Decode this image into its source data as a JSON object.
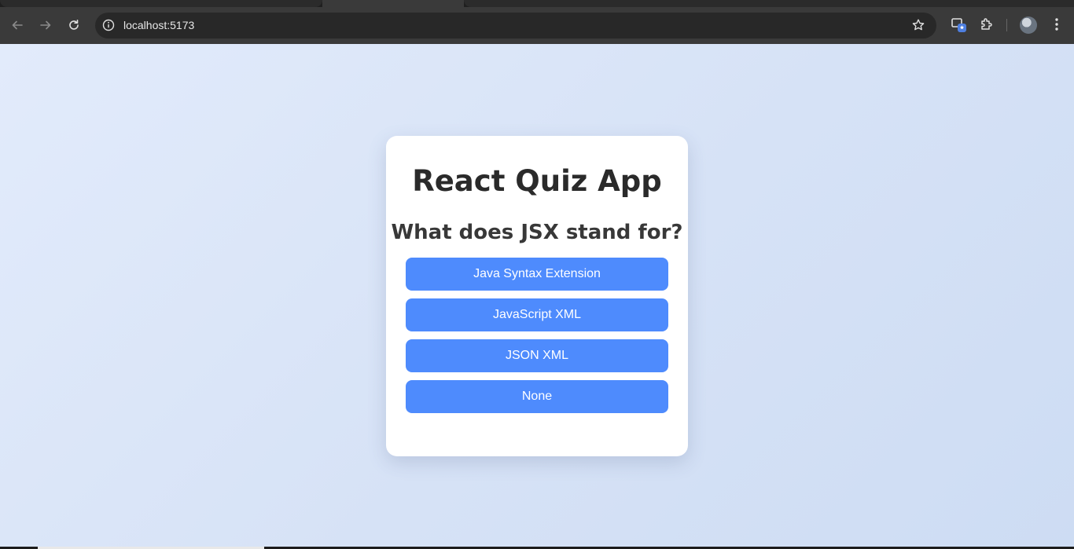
{
  "browser": {
    "url": "localhost:5173"
  },
  "quiz": {
    "title": "React Quiz App",
    "question": "What does JSX stand for?",
    "options": [
      {
        "label": "Java Syntax Extension"
      },
      {
        "label": "JavaScript XML"
      },
      {
        "label": "JSON XML"
      },
      {
        "label": "None"
      }
    ]
  },
  "colors": {
    "button": "#4e8bfd",
    "card": "#ffffff",
    "background": "#dde7f8"
  },
  "icons": [
    "back-arrow-icon",
    "forward-arrow-icon",
    "reload-icon",
    "site-info-icon",
    "bookmark-star-icon",
    "tab-search-icon",
    "extensions-icon",
    "profile-avatar-icon",
    "menu-kebab-icon"
  ]
}
